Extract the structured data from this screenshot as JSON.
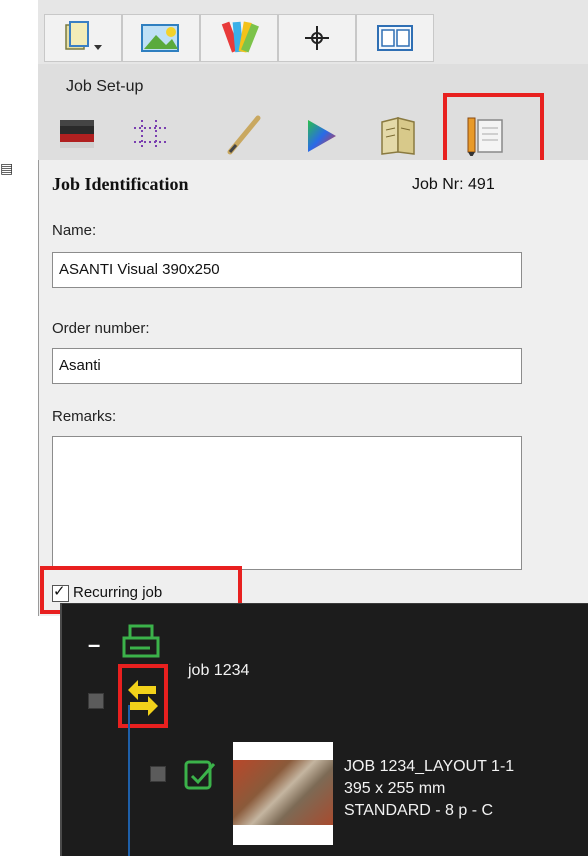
{
  "toolbar": {
    "tabs": [
      {
        "icon": "document-dropdown-icon"
      },
      {
        "icon": "image-place-icon"
      },
      {
        "icon": "color-swatches-icon"
      },
      {
        "icon": "crosshair-icon"
      },
      {
        "icon": "layout-panels-icon"
      }
    ]
  },
  "job_setup": {
    "label": "Job Set-up",
    "subtoolbar": [
      {
        "icon": "media-stack-icon"
      },
      {
        "icon": "grid-marks-icon"
      },
      {
        "icon": "pen-icon"
      },
      {
        "icon": "color-profile-icon"
      },
      {
        "icon": "book-pages-icon"
      },
      {
        "icon": "job-notes-icon",
        "highlighted": true
      }
    ]
  },
  "job_identification": {
    "title": "Job Identification",
    "job_nr": "Job Nr: 491",
    "name_label": "Name:",
    "name_value": "ASANTI Visual 390x250",
    "order_label": "Order number:",
    "order_value": "Asanti",
    "remarks_label": "Remarks:",
    "remarks_value": "",
    "recurring_label": "Recurring job",
    "recurring_checked": true
  },
  "job_tree": {
    "collapse_glyph": "–",
    "job_name": "job 1234",
    "layout": {
      "line1": "JOB 1234_LAYOUT 1-1",
      "line2": "395 x 255 mm",
      "line3": "STANDARD - 8 p - C"
    }
  },
  "colors": {
    "highlight": "#e8201f",
    "green_icon": "#3bb24a",
    "yellow_icon": "#f2d21a",
    "tree_line": "#1e5fa8"
  }
}
